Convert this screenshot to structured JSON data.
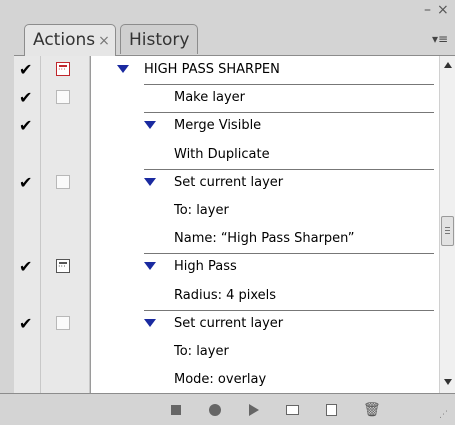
{
  "window": {
    "minimize_glyph": "–",
    "close_glyph": "×"
  },
  "tabs": [
    {
      "label": "Actions",
      "close_glyph": "×",
      "active": true
    },
    {
      "label": "History",
      "active": false
    }
  ],
  "panel_menu_glyph": "▾≡",
  "rows": [
    {
      "text": "HIGH PASS SHARPEN",
      "check": "✔",
      "dialog": "red",
      "arrow": true,
      "level": 0
    },
    {
      "text": "Make layer",
      "check": "✔",
      "dialog": "empty",
      "arrow": false,
      "level": 2
    },
    {
      "text": "Merge Visible",
      "check": "✔",
      "dialog": "none",
      "arrow": true,
      "level": 1
    },
    {
      "text": "With Duplicate",
      "check": "",
      "dialog": "none",
      "arrow": false,
      "level": 2
    },
    {
      "text": "Set current layer",
      "check": "✔",
      "dialog": "empty",
      "arrow": true,
      "level": 1
    },
    {
      "text": "To: layer",
      "check": "",
      "dialog": "none",
      "arrow": false,
      "level": 2
    },
    {
      "text": "Name:  “High Pass Sharpen”",
      "check": "",
      "dialog": "none",
      "arrow": false,
      "level": 2
    },
    {
      "text": "High Pass",
      "check": "✔",
      "dialog": "on",
      "arrow": true,
      "level": 1
    },
    {
      "text": "Radius: 4 pixels",
      "check": "",
      "dialog": "none",
      "arrow": false,
      "level": 2
    },
    {
      "text": "Set current layer",
      "check": "✔",
      "dialog": "empty",
      "arrow": true,
      "level": 1
    },
    {
      "text": "To: layer",
      "check": "",
      "dialog": "none",
      "arrow": false,
      "level": 2
    },
    {
      "text": "Mode: overlay",
      "check": "",
      "dialog": "none",
      "arrow": false,
      "level": 2
    }
  ],
  "toolbar": {
    "buttons": [
      {
        "name": "stop-button",
        "icon": "stop-icon"
      },
      {
        "name": "record-button",
        "icon": "record-icon"
      },
      {
        "name": "play-button",
        "icon": "play-icon"
      },
      {
        "name": "new-set-button",
        "icon": "folder-icon"
      },
      {
        "name": "new-action-button",
        "icon": "new-page-icon"
      },
      {
        "name": "delete-button",
        "icon": "trash-icon"
      }
    ],
    "trash_glyph": "🗑"
  },
  "resize_grip_glyph": "⋰"
}
